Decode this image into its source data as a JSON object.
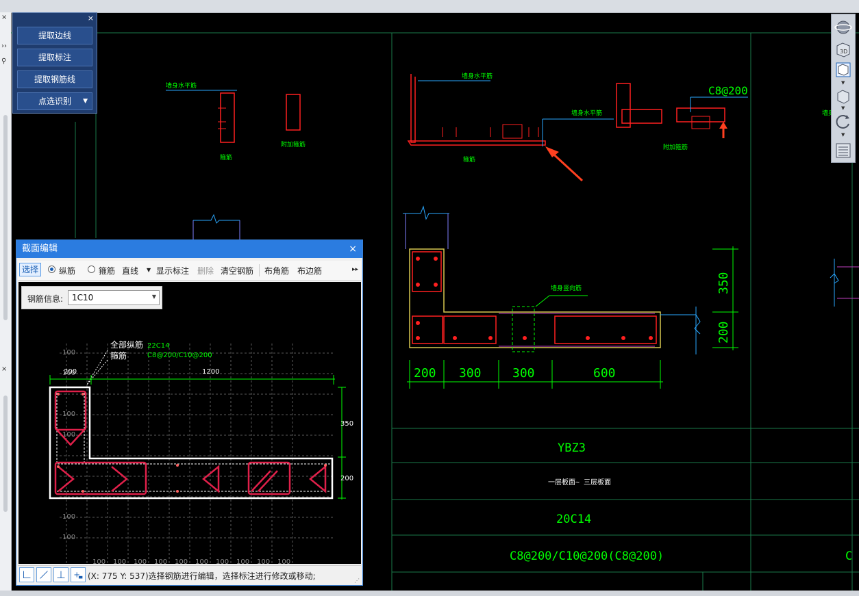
{
  "extract_panel": {
    "close": "×",
    "buttons": [
      "提取边线",
      "提取标注",
      "提取钢筋线",
      "点选识别"
    ]
  },
  "cad": {
    "labels_wall_h": [
      "墙身水平筋",
      "墙身水平筋",
      "墙身水平筋"
    ],
    "label_stirrup": "箍筋",
    "label_stirrup2": "箍筋",
    "label_add_stirrup": "附加箍筋",
    "label_add_stirrup2": "附加箍筋",
    "label_c8": "C8@200",
    "label_vertical": "墙身竖向筋",
    "dim_bottom": [
      "200",
      "300",
      "300",
      "600"
    ],
    "dim_right": [
      "350",
      "200"
    ],
    "table": {
      "name": "YBZ3",
      "elevation": "一层板面~ 三层板面",
      "longitudinal": "20C14",
      "stirrup": "C8@200/C10@200(C8@200)",
      "right_cut": "C"
    },
    "right_label": "墙身水平筋"
  },
  "right_toolbar": {
    "icons": [
      "orbit-icon",
      "3d-view-icon",
      "cube-view-icon",
      "box-icon",
      "rotate-icon",
      "settings-panel-icon"
    ],
    "view3d": "3D"
  },
  "dialog": {
    "title": "截面编辑",
    "close": "×",
    "toolbar": {
      "select": "选择",
      "longitudinal": "纵筋",
      "stirrup": "箍筋",
      "line": "直线",
      "show_dim": "显示标注",
      "delete": "删除",
      "clear": "清空钢筋",
      "corner": "布角筋",
      "edge": "布边筋",
      "more": "▸▸"
    },
    "rebar_info_label": "钢筋信息:",
    "rebar_info_value": "1C10",
    "canvas": {
      "legend1": "全部纵筋",
      "legend1_val": "22C14",
      "legend2": "箍筋",
      "legend2_val": "C8@200/C10@200",
      "dim_top": [
        "200",
        "1200"
      ],
      "dim_right": [
        "350",
        "200"
      ],
      "grid_label": "100"
    },
    "status": "(X: 775 Y: 537)选择钢筋进行编辑，选择标注进行修改或移动;"
  },
  "colors": {
    "cad_green": "#00ff00",
    "cad_red": "#ff2020",
    "cad_cyan": "#2aa8ff",
    "cad_yellow": "#d8c850",
    "cad_line": "#1a7a4a",
    "title_blue": "#2b7ce0",
    "panel_blue": "#1f3c6e"
  }
}
